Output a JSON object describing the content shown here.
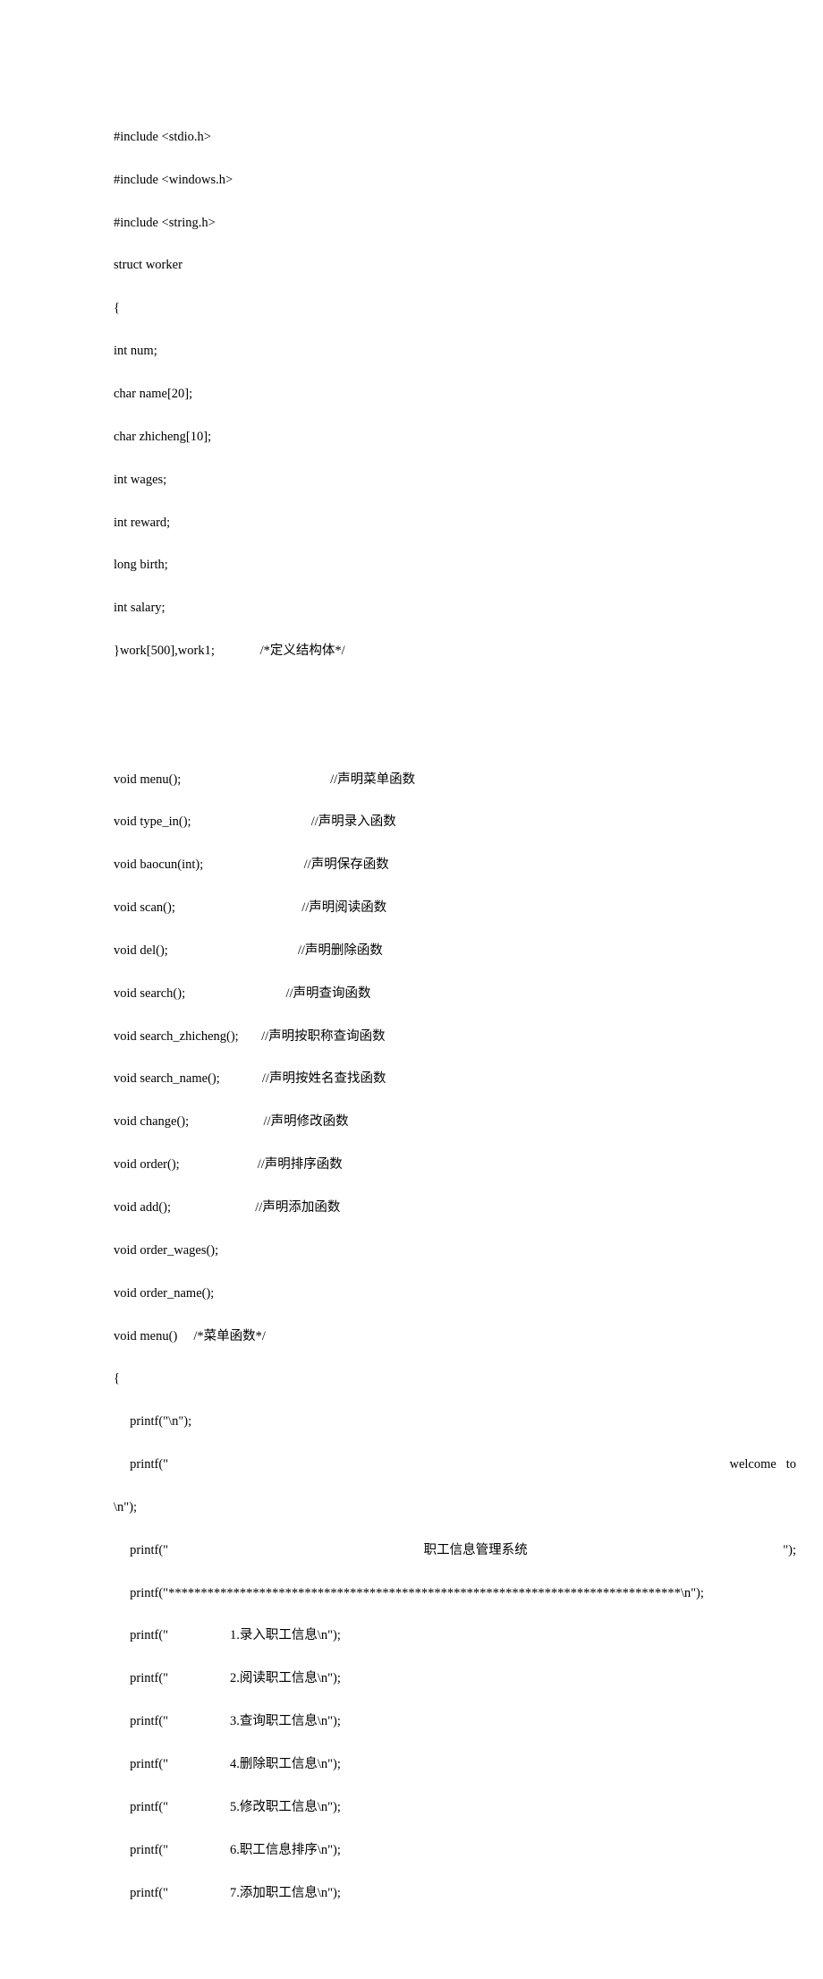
{
  "lines": {
    "l1": "#include <stdio.h>",
    "l2": "#include <windows.h>",
    "l3": "#include <string.h>",
    "l4": "struct worker",
    "l5": "{",
    "l6": "int num;",
    "l7": "char name[20];",
    "l8": "char zhicheng[10];",
    "l9": "int wages;",
    "l10": "int reward;",
    "l11": "long birth;",
    "l12": "int salary;",
    "l13_left": "}work[500],work1;",
    "l13_right": "/*定义结构体*/",
    "l14_left": "void menu();",
    "l14_right": "//声明菜单函数",
    "l15_left": "void type_in();",
    "l15_right": "//声明录入函数",
    "l16_left": "void baocun(int);",
    "l16_right": "//声明保存函数",
    "l17_left": "void scan();",
    "l17_right": "//声明阅读函数",
    "l18_left": "void del();",
    "l18_right": "//声明删除函数",
    "l19_left": "void search();",
    "l19_right": "//声明查询函数",
    "l20_left": "void search_zhicheng();",
    "l20_right": "//声明按职称查询函数",
    "l21_left": "void search_name();",
    "l21_right": "//声明按姓名查找函数",
    "l22_left": "void change();",
    "l22_right": "//声明修改函数",
    "l23_left": "void order();",
    "l23_right": "//声明排序函数",
    "l24_left": "void add();",
    "l24_right": "//声明添加函数",
    "l25": "void order_wages();",
    "l26": "void order_name();",
    "l27": "void menu()     /*菜单函数*/",
    "l28": "{",
    "l29": "     printf(\"\\n\");",
    "l30_left": "     printf(\"",
    "l30_right": "welcome   to",
    "l31": "\\n\");",
    "l32_left": "     printf(\"",
    "l32_mid": "职工信息管理系统",
    "l32_right": "\");",
    "l33": "     printf(\"*******************************************************************************\\n\");",
    "l34": "     printf(\"                   1.录入职工信息\\n\");",
    "l35": "     printf(\"                   2.阅读职工信息\\n\");",
    "l36": "     printf(\"                   3.查询职工信息\\n\");",
    "l37": "     printf(\"                   4.删除职工信息\\n\");",
    "l38": "     printf(\"                   5.修改职工信息\\n\");",
    "l39": "     printf(\"                   6.职工信息排序\\n\");",
    "l40": "     printf(\"                   7.添加职工信息\\n\");"
  }
}
